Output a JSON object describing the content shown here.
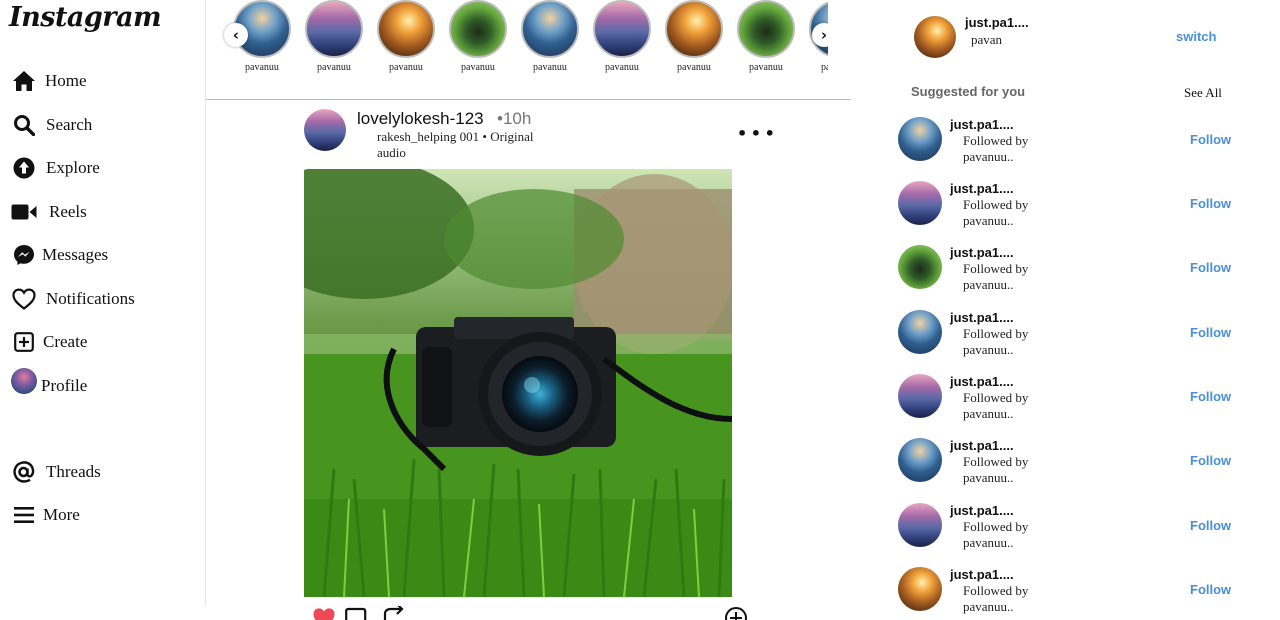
{
  "app": {
    "logo": "Instagram"
  },
  "sidebar": {
    "items": [
      {
        "label": "Home",
        "icon": "home-icon"
      },
      {
        "label": "Search",
        "icon": "search-icon"
      },
      {
        "label": "Explore",
        "icon": "explore-icon"
      },
      {
        "label": "Reels",
        "icon": "reels-icon"
      },
      {
        "label": "Messages",
        "icon": "messenger-icon"
      },
      {
        "label": "Notifications",
        "icon": "heart-icon"
      },
      {
        "label": "Create",
        "icon": "plus-square-icon"
      },
      {
        "label": "Profile",
        "icon": "profile-avatar"
      },
      {
        "label": "Threads",
        "icon": "threads-icon"
      },
      {
        "label": "More",
        "icon": "menu-icon"
      }
    ]
  },
  "stories": {
    "items": [
      {
        "name": "pavanuu"
      },
      {
        "name": "pavanuu"
      },
      {
        "name": "pavanuu"
      },
      {
        "name": "pavanuu"
      },
      {
        "name": "pavanuu"
      },
      {
        "name": "pavanuu"
      },
      {
        "name": "pavanuu"
      },
      {
        "name": "pavanuu"
      },
      {
        "name": "pavanuu"
      }
    ],
    "prev_icon": "chevron-left-icon",
    "next_icon": "chevron-right-icon"
  },
  "post": {
    "username": "lovelylokesh-123",
    "time": "10h",
    "audio_line1": "rakesh_helping 001 • Original",
    "audio_line2": "audio",
    "more_icon": "more-dots-icon",
    "image_subject": "camera-in-grass-photo",
    "actions": [
      "heart-icon",
      "comment-icon",
      "share-icon",
      "add-circle-icon"
    ],
    "liked_color": "#ed4956"
  },
  "current_user": {
    "username": "just.pa1....",
    "full_name": "pavan",
    "switch_label": "switch"
  },
  "suggestions": {
    "heading": "Suggested for you",
    "see_all": "See All",
    "items": [
      {
        "username": "just.pa1....",
        "followed_line1": "Followed by",
        "followed_line2": "pavanuu..",
        "follow_label": "Follow"
      },
      {
        "username": "just.pa1....",
        "followed_line1": "Followed by",
        "followed_line2": "pavanuu..",
        "follow_label": "Follow"
      },
      {
        "username": "just.pa1....",
        "followed_line1": "Followed by",
        "followed_line2": "pavanuu..",
        "follow_label": "Follow"
      },
      {
        "username": "just.pa1....",
        "followed_line1": "Followed by",
        "followed_line2": "pavanuu..",
        "follow_label": "Follow"
      },
      {
        "username": "just.pa1....",
        "followed_line1": "Followed by",
        "followed_line2": "pavanuu..",
        "follow_label": "Follow"
      },
      {
        "username": "just.pa1....",
        "followed_line1": "Followed by",
        "followed_line2": "pavanuu..",
        "follow_label": "Follow"
      },
      {
        "username": "just.pa1....",
        "followed_line1": "Followed by",
        "followed_line2": "pavanuu..",
        "follow_label": "Follow"
      },
      {
        "username": "just.pa1....",
        "followed_line1": "Followed by",
        "followed_line2": "pavanuu..",
        "follow_label": "Follow"
      }
    ]
  },
  "colors": {
    "link_blue": "#4a90d9",
    "muted_gray": "#666666",
    "divider": "#b8b8b8"
  }
}
